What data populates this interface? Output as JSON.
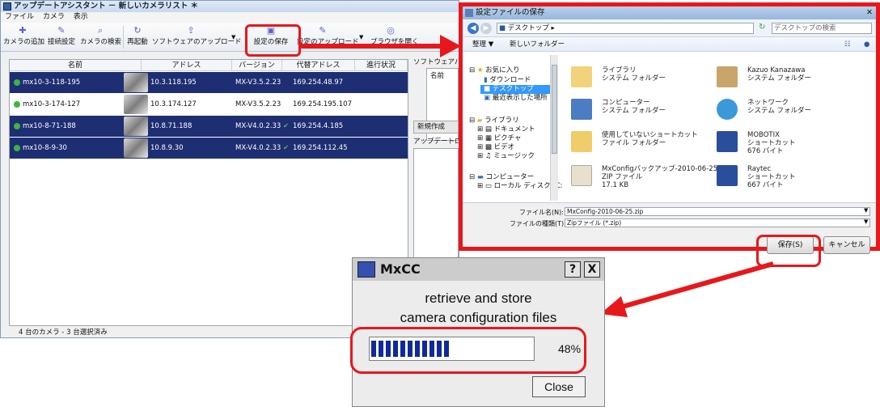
{
  "app": {
    "title": "アップデートアシスタント － 新しいカメラリスト ＊",
    "menu": [
      "ファイル",
      "カメラ",
      "表示"
    ],
    "toolbar": {
      "add_camera": "カメラの追加",
      "connection_settings": "接続設定",
      "search_camera": "カメラの検索",
      "reboot": "再起動",
      "upload_software": "ソフトウェアのアップロード",
      "save_config": "設定の保存",
      "upload_config": "設定のアップロード",
      "open_browser": "ブラウザを開く"
    },
    "table": {
      "columns": [
        "名前",
        "アドレス",
        "バージョン",
        "代替アドレス",
        "進行状況"
      ],
      "rows": [
        {
          "name": "mx10-3-118-195",
          "address": "10.3.118.195",
          "version": "MX-V3.5.2.23",
          "alt": "169.254.48.97",
          "checked": false,
          "selected": true
        },
        {
          "name": "mx10-3-174-127",
          "address": "10.3.174.127",
          "version": "MX-V3.5.2.23",
          "alt": "169.254.195.107",
          "checked": false,
          "selected": false
        },
        {
          "name": "mx10-8-71-188",
          "address": "10.8.71.188",
          "version": "MX-V4.0.2.33",
          "alt": "169.254.4.185",
          "checked": true,
          "selected": true
        },
        {
          "name": "mx10-8-9-30",
          "address": "10.8.9.30",
          "version": "MX-V4.0.2.33",
          "alt": "169.254.112.45",
          "checked": true,
          "selected": true
        }
      ]
    },
    "side_panel": {
      "software_header": "ソフトウェアパッ",
      "name_col": "名前",
      "new_button": "新規作成",
      "update_log": "アップデートログ"
    },
    "status": "4 台のカメラ - 3 台選択済み"
  },
  "save_dialog": {
    "title": "設定ファイルの保存",
    "address_path": "デスクトップ",
    "search_placeholder": "デスクトップの検索",
    "organize": "整理 ▼",
    "new_folder": "新しいフォルダー",
    "tree": [
      "お気に入り",
      "ダウンロード",
      "デスクトップ",
      "最近表示した場所",
      "ライブラリ",
      "ドキュメント",
      "ピクチャ",
      "ビデオ",
      "ミュージック",
      "コンピューター",
      "ローカル ディスク (C:"
    ],
    "files": [
      {
        "name": "ライブラリ\nシステム フォルダー",
        "icon": "library-icon"
      },
      {
        "name": "Kazuo Kanazawa\nシステム フォルダー",
        "icon": "user-folder-icon"
      },
      {
        "name": "コンピューター\nシステム フォルダー",
        "icon": "computer-icon"
      },
      {
        "name": "ネットワーク\nシステム フォルダー",
        "icon": "network-icon"
      },
      {
        "name": "使用していないショートカット\nファイル フォルダー",
        "icon": "folder-icon"
      },
      {
        "name": "MOBOTIX\nショートカット\n676 バイト",
        "icon": "shortcut-icon"
      },
      {
        "name": "MxConfigバックアップ-2010-06-25.zip\nZIP ファイル\n17.1 KB",
        "icon": "zip-icon"
      },
      {
        "name": "Raytec\nショートカット\n667 バイト",
        "icon": "shortcut-icon"
      }
    ],
    "filename_label": "ファイル名(N):",
    "filename_value": "MxConfig-2010-06-25.zip",
    "filetype_label": "ファイルの種類(T):",
    "filetype_value": "Zipファイル (*.zip)",
    "save_button": "保存(S)",
    "cancel_button": "キャンセル"
  },
  "progress_dialog": {
    "title": "MxCC",
    "help": "?",
    "close_x": "X",
    "message_line1": "retrieve and store",
    "message_line2": "camera configuration files",
    "progress": 48,
    "progress_text": "48%",
    "close_button": "Close"
  },
  "colors": {
    "highlight": "#e8171c",
    "selection": "#1d2e72",
    "progress": "#0f2a9a"
  }
}
